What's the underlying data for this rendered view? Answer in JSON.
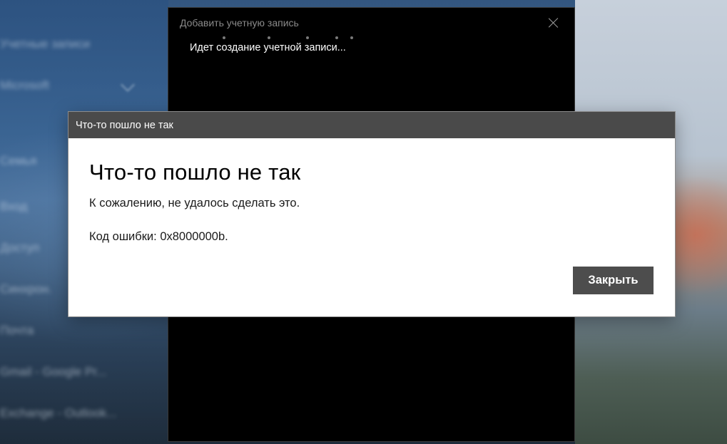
{
  "background_app": {
    "ghost_items": [
      "Учетные записи",
      "Microsoft",
      "Семья",
      "Вход",
      "Доступ",
      "Синхрон.",
      "Почта",
      "Gmail - Google Pr...",
      "Exchange - Outlook..."
    ]
  },
  "account_window": {
    "title": "Добавить учетную запись",
    "status": "Идет создание учетной записи...",
    "close_icon": "close-icon"
  },
  "error_dialog": {
    "titlebar": "Что-то пошло не так",
    "heading": "Что-то пошло не так",
    "message": "К сожалению, не удалось сделать это.",
    "error_code": "Код ошибки: 0x8000000b.",
    "close_button": "Закрыть"
  },
  "colors": {
    "dialog_titlebar": "#4a4a4a",
    "button": "#4d4d4d",
    "window_bg": "#000000"
  }
}
